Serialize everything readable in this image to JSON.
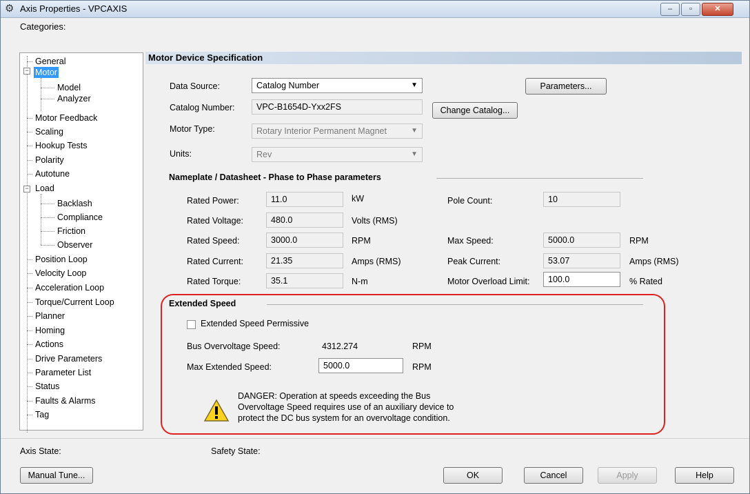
{
  "window": {
    "title": "Axis Properties - VPCAXIS",
    "minimize": "–",
    "maximize": "▫",
    "close": "✕"
  },
  "categories_label": "Categories:",
  "tree": {
    "general": "General",
    "motor": "Motor",
    "model": "Model",
    "analyzer": "Analyzer",
    "motor_feedback": "Motor Feedback",
    "scaling": "Scaling",
    "hookup_tests": "Hookup Tests",
    "polarity": "Polarity",
    "autotune": "Autotune",
    "load": "Load",
    "backlash": "Backlash",
    "compliance": "Compliance",
    "friction": "Friction",
    "observer": "Observer",
    "position_loop": "Position Loop",
    "velocity_loop": "Velocity Loop",
    "acceleration_loop": "Acceleration Loop",
    "torque_current_loop": "Torque/Current Loop",
    "planner": "Planner",
    "homing": "Homing",
    "actions": "Actions",
    "drive_parameters": "Drive Parameters",
    "parameter_list": "Parameter List",
    "status": "Status",
    "faults_alarms": "Faults & Alarms",
    "tag": "Tag"
  },
  "section_title": "Motor Device Specification",
  "spec": {
    "data_source_label": "Data Source:",
    "data_source_value": "Catalog Number",
    "parameters_button": "Parameters...",
    "catalog_number_label": "Catalog Number:",
    "catalog_number_value": "VPC-B1654D-Yxx2FS",
    "change_catalog_button": "Change Catalog...",
    "motor_type_label": "Motor Type:",
    "motor_type_value": "Rotary Interior Permanent Magnet",
    "units_label": "Units:",
    "units_value": "Rev"
  },
  "nameplate": {
    "heading": "Nameplate / Datasheet - Phase to Phase parameters",
    "rated_power_label": "Rated Power:",
    "rated_power": "11.0",
    "rated_power_unit": "kW",
    "rated_voltage_label": "Rated Voltage:",
    "rated_voltage": "480.0",
    "rated_voltage_unit": "Volts (RMS)",
    "rated_speed_label": "Rated Speed:",
    "rated_speed": "3000.0",
    "rated_speed_unit": "RPM",
    "rated_current_label": "Rated Current:",
    "rated_current": "21.35",
    "rated_current_unit": "Amps (RMS)",
    "rated_torque_label": "Rated Torque:",
    "rated_torque": "35.1",
    "rated_torque_unit": "N-m",
    "pole_count_label": "Pole Count:",
    "pole_count": "10",
    "max_speed_label": "Max Speed:",
    "max_speed": "5000.0",
    "max_speed_unit": "RPM",
    "peak_current_label": "Peak Current:",
    "peak_current": "53.07",
    "peak_current_unit": "Amps (RMS)",
    "overload_label": "Motor Overload Limit:",
    "overload": "100.0",
    "overload_unit": "% Rated"
  },
  "extended": {
    "heading": "Extended Speed",
    "permissive_label": "Extended Speed Permissive",
    "bus_overvoltage_label": "Bus Overvoltage Speed:",
    "bus_overvoltage": "4312.274",
    "bus_overvoltage_unit": "RPM",
    "max_extended_label": "Max Extended Speed:",
    "max_extended": "5000.0",
    "max_extended_unit": "RPM",
    "danger_line1": "DANGER: Operation at speeds exceeding the Bus",
    "danger_line2": "Overvoltage Speed requires use of an auxiliary device to",
    "danger_line3": "protect the DC bus system for an overvoltage condition."
  },
  "footer": {
    "axis_state_label": "Axis State:",
    "safety_state_label": "Safety State:",
    "manual_tune": "Manual Tune...",
    "ok": "OK",
    "cancel": "Cancel",
    "apply": "Apply",
    "help": "Help"
  },
  "colors": {
    "accent_red": "#e02020",
    "selection": "#3399ff"
  }
}
